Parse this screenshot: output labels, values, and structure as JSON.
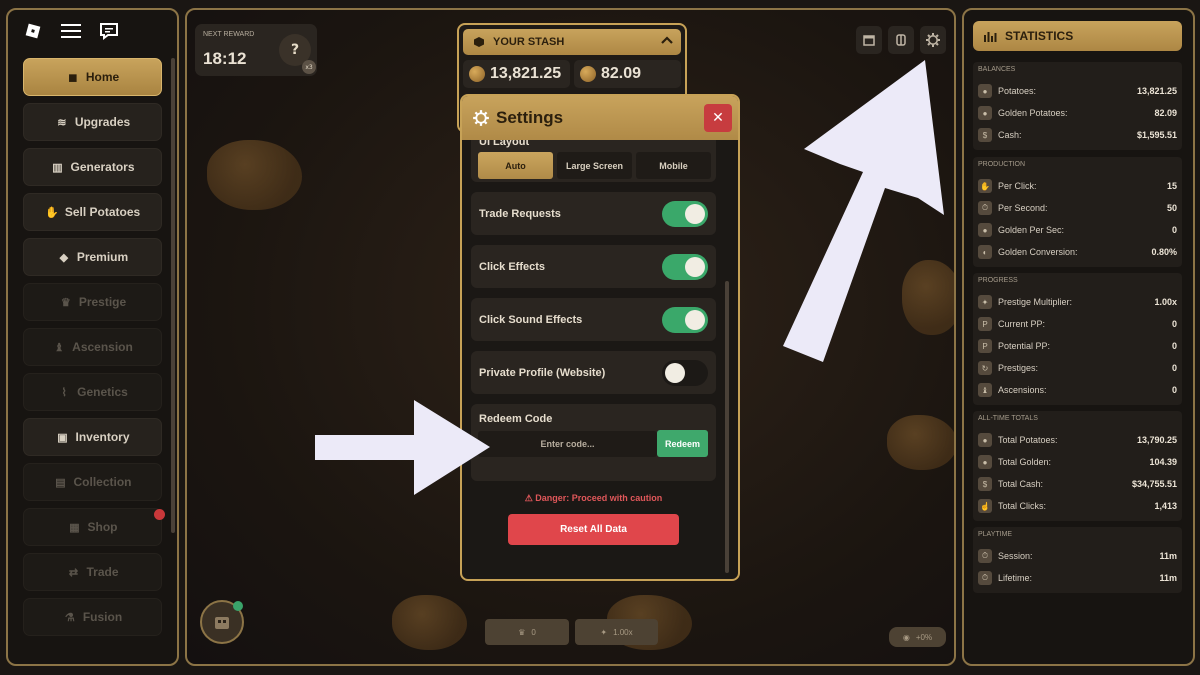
{
  "app": {
    "brand": "roblox-logo"
  },
  "left_nav": {
    "items": [
      {
        "label": "Home",
        "icon": "cube-icon",
        "state": "active"
      },
      {
        "label": "Upgrades",
        "icon": "wifi-icon",
        "state": "normal"
      },
      {
        "label": "Generators",
        "icon": "factory-icon",
        "state": "normal"
      },
      {
        "label": "Sell Potatoes",
        "icon": "hand-coin-icon",
        "state": "normal"
      },
      {
        "label": "Premium",
        "icon": "diamond-icon",
        "state": "normal"
      },
      {
        "label": "Prestige",
        "icon": "crown-icon",
        "state": "locked"
      },
      {
        "label": "Ascension",
        "icon": "chess-icon",
        "state": "locked"
      },
      {
        "label": "Genetics",
        "icon": "dna-icon",
        "state": "locked"
      },
      {
        "label": "Inventory",
        "icon": "robot-icon",
        "state": "normal"
      },
      {
        "label": "Collection",
        "icon": "book-icon",
        "state": "locked"
      },
      {
        "label": "Shop",
        "icon": "shop-icon",
        "state": "locked"
      },
      {
        "label": "Trade",
        "icon": "trade-icon",
        "state": "locked"
      },
      {
        "label": "Fusion",
        "icon": "flask-icon",
        "state": "locked"
      }
    ]
  },
  "reward": {
    "label": "NEXT REWARD",
    "time": "18:12",
    "mystery": "?",
    "multiplier": "x3"
  },
  "stash": {
    "title": "YOUR STASH",
    "potatoes": "13,821.25",
    "golden": "82.09"
  },
  "bottom": {
    "prestige_count": "0",
    "multiplier": "1.00x",
    "bonus": "+0%"
  },
  "settings": {
    "title": "Settings",
    "layout_label": "UI Layout",
    "layout_options": [
      "Auto",
      "Large Screen",
      "Mobile"
    ],
    "layout_selected": "Auto",
    "toggles": [
      {
        "label": "Trade Requests",
        "on": true
      },
      {
        "label": "Click Effects",
        "on": true
      },
      {
        "label": "Click Sound Effects",
        "on": true
      },
      {
        "label": "Private Profile (Website)",
        "on": false
      }
    ],
    "redeem_label": "Redeem Code",
    "redeem_placeholder": "Enter code...",
    "redeem_button": "Redeem",
    "danger_text": "⚠ Danger: Proceed with caution",
    "reset_button": "Reset All Data"
  },
  "statistics": {
    "title": "STATISTICS",
    "sections": [
      {
        "title": "BALANCES",
        "rows": [
          {
            "label": "Potatoes:",
            "value": "13,821.25"
          },
          {
            "label": "Golden Potatoes:",
            "value": "82.09"
          },
          {
            "label": "Cash:",
            "value": "$1,595.51"
          }
        ]
      },
      {
        "title": "PRODUCTION",
        "rows": [
          {
            "label": "Per Click:",
            "value": "15"
          },
          {
            "label": "Per Second:",
            "value": "50"
          },
          {
            "label": "Golden Per Sec:",
            "value": "0"
          },
          {
            "label": "Golden Conversion:",
            "value": "0.80%"
          }
        ]
      },
      {
        "title": "PROGRESS",
        "rows": [
          {
            "label": "Prestige Multiplier:",
            "value": "1.00x"
          },
          {
            "label": "Current PP:",
            "value": "0"
          },
          {
            "label": "Potential PP:",
            "value": "0"
          },
          {
            "label": "Prestiges:",
            "value": "0"
          },
          {
            "label": "Ascensions:",
            "value": "0"
          }
        ]
      },
      {
        "title": "ALL-TIME TOTALS",
        "rows": [
          {
            "label": "Total Potatoes:",
            "value": "13,790.25"
          },
          {
            "label": "Total Golden:",
            "value": "104.39"
          },
          {
            "label": "Total Cash:",
            "value": "$34,755.51"
          },
          {
            "label": "Total Clicks:",
            "value": "1,413"
          }
        ]
      },
      {
        "title": "PLAYTIME",
        "rows": [
          {
            "label": "Session:",
            "value": "11m"
          },
          {
            "label": "Lifetime:",
            "value": "11m"
          }
        ]
      }
    ]
  },
  "colors": {
    "gold": "#c8a35c",
    "green": "#3aa86a",
    "red": "#e0464b",
    "arrow": "#eceaf8"
  }
}
